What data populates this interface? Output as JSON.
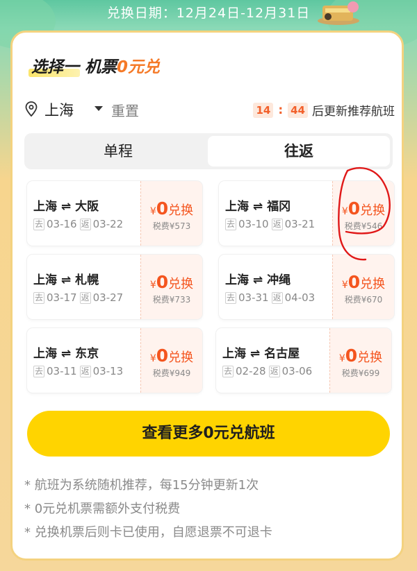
{
  "header": {
    "date_label": "兑换日期：",
    "date_range": "12月24日-12月31日"
  },
  "title": {
    "prefix": "选择一 机票",
    "highlight": "0元兑"
  },
  "location": {
    "city": "上海",
    "reset": "重置"
  },
  "timer": {
    "minutes": "14",
    "seconds": "44",
    "text": "后更新推荐航班"
  },
  "tabs": [
    {
      "label": "单程"
    },
    {
      "label": "往返"
    }
  ],
  "active_tab": "往返",
  "flights": [
    {
      "from": "上海",
      "arrow": "⇌",
      "to": "大阪",
      "go_tag": "去",
      "go_date": "03-16",
      "back_tag": "返",
      "back_date": "03-22",
      "yen": "¥",
      "amount": "0",
      "redeem": "兑换",
      "tax": "税费¥573"
    },
    {
      "from": "上海",
      "arrow": "⇌",
      "to": "福冈",
      "go_tag": "去",
      "go_date": "03-10",
      "back_tag": "返",
      "back_date": "03-21",
      "yen": "¥",
      "amount": "0",
      "redeem": "兑换",
      "tax": "税费¥546"
    },
    {
      "from": "上海",
      "arrow": "⇌",
      "to": "札幌",
      "go_tag": "去",
      "go_date": "03-17",
      "back_tag": "返",
      "back_date": "03-27",
      "yen": "¥",
      "amount": "0",
      "redeem": "兑换",
      "tax": "税费¥733"
    },
    {
      "from": "上海",
      "arrow": "⇌",
      "to": "冲绳",
      "go_tag": "去",
      "go_date": "03-31",
      "back_tag": "返",
      "back_date": "04-03",
      "yen": "¥",
      "amount": "0",
      "redeem": "兑换",
      "tax": "税费¥670"
    },
    {
      "from": "上海",
      "arrow": "⇌",
      "to": "东京",
      "go_tag": "去",
      "go_date": "03-11",
      "back_tag": "返",
      "back_date": "03-13",
      "yen": "¥",
      "amount": "0",
      "redeem": "兑换",
      "tax": "税费¥949"
    },
    {
      "from": "上海",
      "arrow": "⇌",
      "to": "名古屋",
      "go_tag": "去",
      "go_date": "02-28",
      "back_tag": "返",
      "back_date": "03-06",
      "yen": "¥",
      "amount": "0",
      "redeem": "兑换",
      "tax": "税费¥699"
    }
  ],
  "cta_label": "查看更多0元兑航班",
  "notes": [
    "* 航班为系统随机推荐，每15分钟更新1次",
    "* 0元兑机票需额外支付税费",
    "* 兑换机票后则卡已使用，自愿退票不可退卡"
  ],
  "colors": {
    "accent": "#f4551f",
    "cta": "#ffd400",
    "border": "#f4d27f"
  },
  "icons": {
    "location": "map-pin-icon",
    "caret": "caret-down-icon"
  }
}
